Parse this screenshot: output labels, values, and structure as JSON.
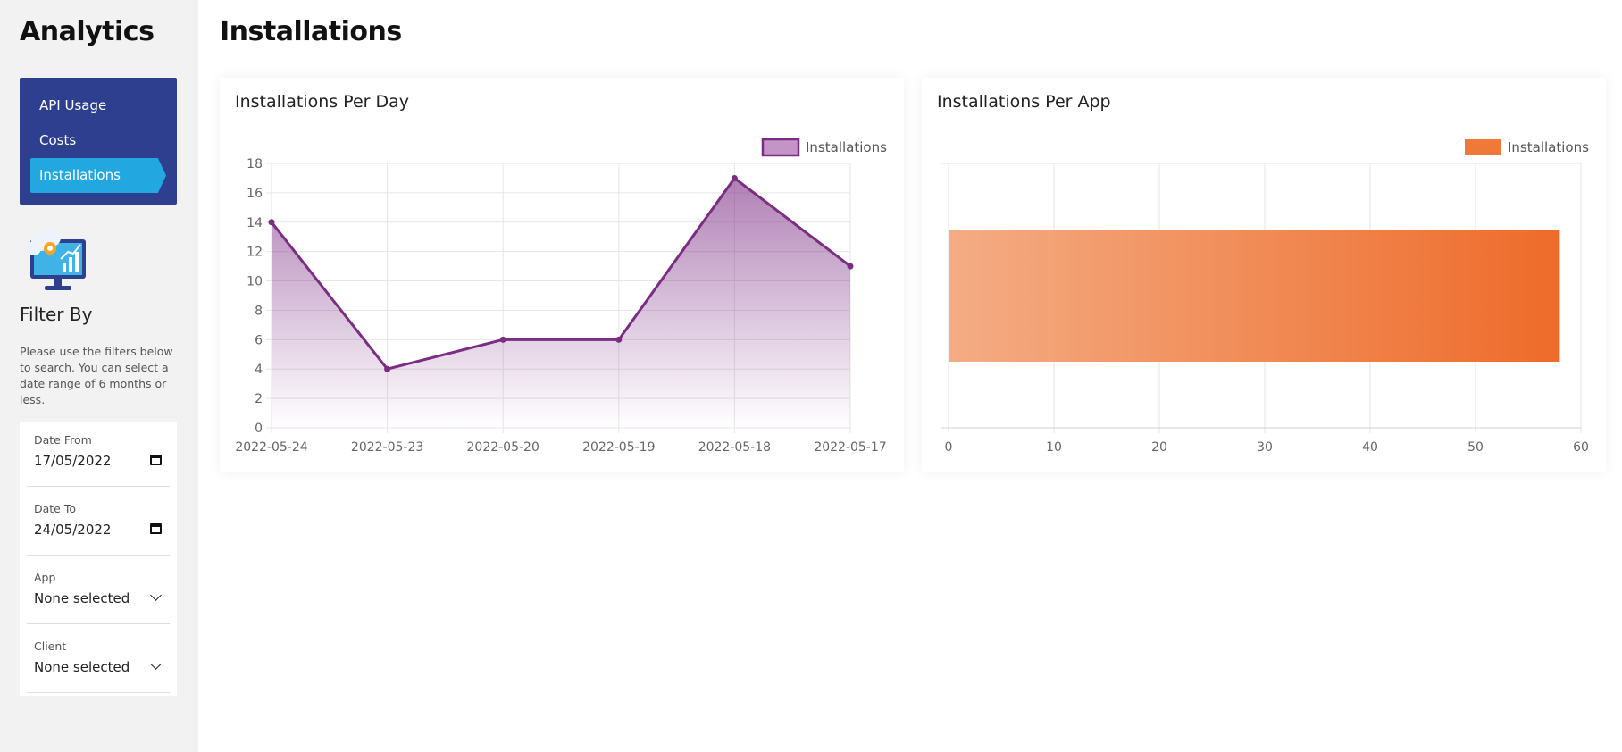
{
  "sidebar": {
    "app_title": "Analytics",
    "nav_items": [
      {
        "label": "API Usage",
        "active": false
      },
      {
        "label": "Costs",
        "active": false
      },
      {
        "label": "Installations",
        "active": true
      }
    ],
    "filter_title": "Filter By",
    "filter_description": "Please use the filters below to search. You can select a date range of 6 months or less.",
    "filters": {
      "date_from": {
        "label": "Date From",
        "value": "17/05/2022",
        "icon": "calendar-icon"
      },
      "date_to": {
        "label": "Date To",
        "value": "24/05/2022",
        "icon": "calendar-icon"
      },
      "app": {
        "label": "App",
        "value": "None selected",
        "icon": "chevron-down-icon"
      },
      "client": {
        "label": "Client",
        "value": "None selected",
        "icon": "chevron-down-icon"
      }
    }
  },
  "main": {
    "page_title": "Installations"
  },
  "colors": {
    "nav_bg": "#2e3f8f",
    "nav_active": "#22a7e0",
    "line_series": "#7b2c83",
    "bar_series": "#ee6b2a"
  },
  "chart_data": [
    {
      "type": "area",
      "title": "Installations Per Day",
      "legend": {
        "label": "Installations",
        "position": "top-right"
      },
      "categories": [
        "2022-05-24",
        "2022-05-23",
        "2022-05-20",
        "2022-05-19",
        "2022-05-18",
        "2022-05-17"
      ],
      "series": [
        {
          "name": "Installations",
          "values": [
            14,
            4,
            6,
            6,
            17,
            11
          ]
        }
      ],
      "ylim": [
        0,
        18
      ],
      "yticks": [
        0,
        2,
        4,
        6,
        8,
        10,
        12,
        14,
        16,
        18
      ],
      "grid": true
    },
    {
      "type": "bar",
      "orientation": "horizontal",
      "title": "Installations Per App",
      "legend": {
        "label": "Installations",
        "position": "top-right"
      },
      "categories": [
        ""
      ],
      "series": [
        {
          "name": "Installations",
          "values": [
            58
          ]
        }
      ],
      "xlim": [
        0,
        60
      ],
      "xticks": [
        0,
        10,
        20,
        30,
        40,
        50,
        60
      ],
      "grid": true
    }
  ]
}
